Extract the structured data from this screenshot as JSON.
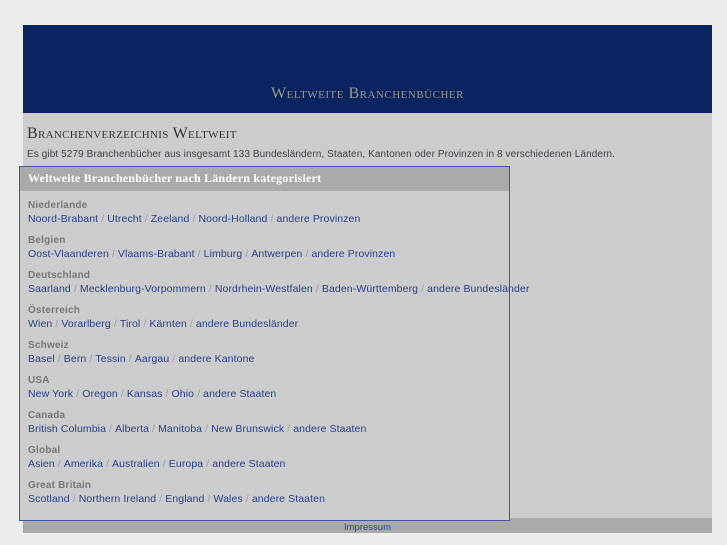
{
  "banner": {
    "title": "Weltweite Branchenbücher"
  },
  "main": {
    "heading": "Branchenverzeichnis Weltweit",
    "subtitle": "Es gibt 5279 Branchenbücher aus insgesamt 133 Bundesländern, Staaten, Kantonen oder Provinzen in 8 verschiedenen Ländern."
  },
  "panel": {
    "header": "Weltweite Branchenbücher nach Ländern kategorisiert",
    "separator": "/",
    "countries": [
      {
        "name": "Niederlande",
        "regions": [
          "Noord-Brabant",
          "Utrecht",
          "Zeeland",
          "Noord-Holland",
          "andere Provinzen"
        ]
      },
      {
        "name": "Belgien",
        "regions": [
          "Oost-Vlaanderen",
          "Vlaams-Brabant",
          "Limburg",
          "Antwerpen",
          "andere Provinzen"
        ]
      },
      {
        "name": "Deutschland",
        "regions": [
          "Saarland",
          "Mecklenburg-Vorpommern",
          "Nordrhein-Westfalen",
          "Baden-Württemberg",
          "andere Bundesländer"
        ]
      },
      {
        "name": "Österreich",
        "regions": [
          "Wien",
          "Vorarlberg",
          "Tirol",
          "Kärnten",
          "andere Bundesländer"
        ]
      },
      {
        "name": "Schweiz",
        "regions": [
          "Basel",
          "Bern",
          "Tessin",
          "Aargau",
          "andere Kantone"
        ]
      },
      {
        "name": "USA",
        "regions": [
          "New York",
          "Oregon",
          "Kansas",
          "Ohio",
          "andere Staaten"
        ]
      },
      {
        "name": "Canada",
        "regions": [
          "British Columbia",
          "Alberta",
          "Manitoba",
          "New Brunswick",
          "andere Staaten"
        ]
      },
      {
        "name": "Global",
        "regions": [
          "Asien",
          "Amerika",
          "Australien",
          "Europa",
          "andere Staaten"
        ]
      },
      {
        "name": "Great Britain",
        "regions": [
          "Scotland",
          "Northern Ireland",
          "England",
          "Wales",
          "andere Staaten"
        ]
      }
    ]
  },
  "footer": {
    "impressum": "Impressum"
  },
  "colors": {
    "banner_bg": "#0a2361",
    "banner_text": "#9a9a8a",
    "page_bg": "#ececec",
    "content_bg": "#cccccc",
    "bar_bg": "#aaaaaa",
    "link": "#27408b",
    "panel_border": "#3b5998"
  }
}
